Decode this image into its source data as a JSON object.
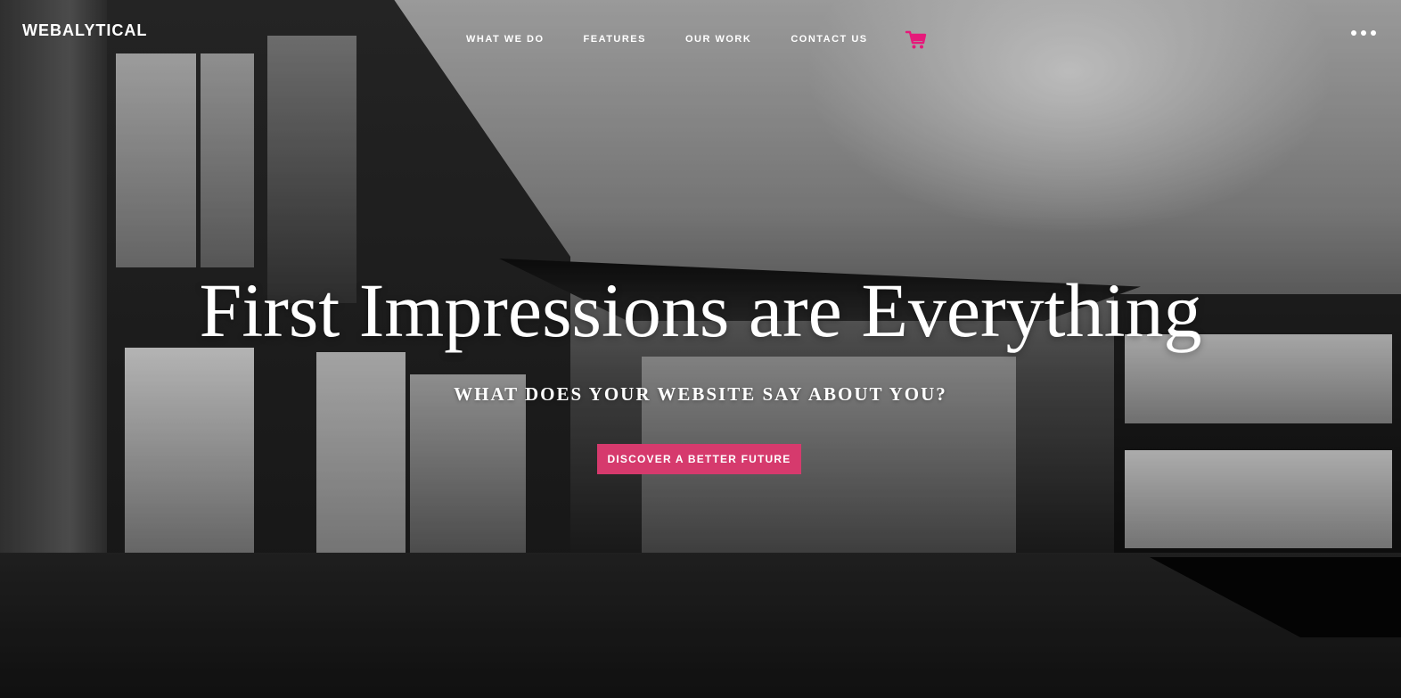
{
  "brand": {
    "logo_text": "WEBALYTICAL",
    "accent_color": "#d63a6d",
    "cart_icon_color": "#e6197a"
  },
  "nav": {
    "items": [
      {
        "label": "WHAT WE DO"
      },
      {
        "label": "FEATURES"
      },
      {
        "label": "OUR WORK"
      },
      {
        "label": "CONTACT US"
      }
    ],
    "cart_icon": "shopping-cart-icon",
    "menu_icon": "more-horizontal-icon"
  },
  "hero": {
    "headline": "First Impressions are Everything",
    "subheadline": "WHAT DOES YOUR WEBSITE SAY ABOUT YOU?",
    "cta_label": "DISCOVER A BETTER FUTURE"
  }
}
